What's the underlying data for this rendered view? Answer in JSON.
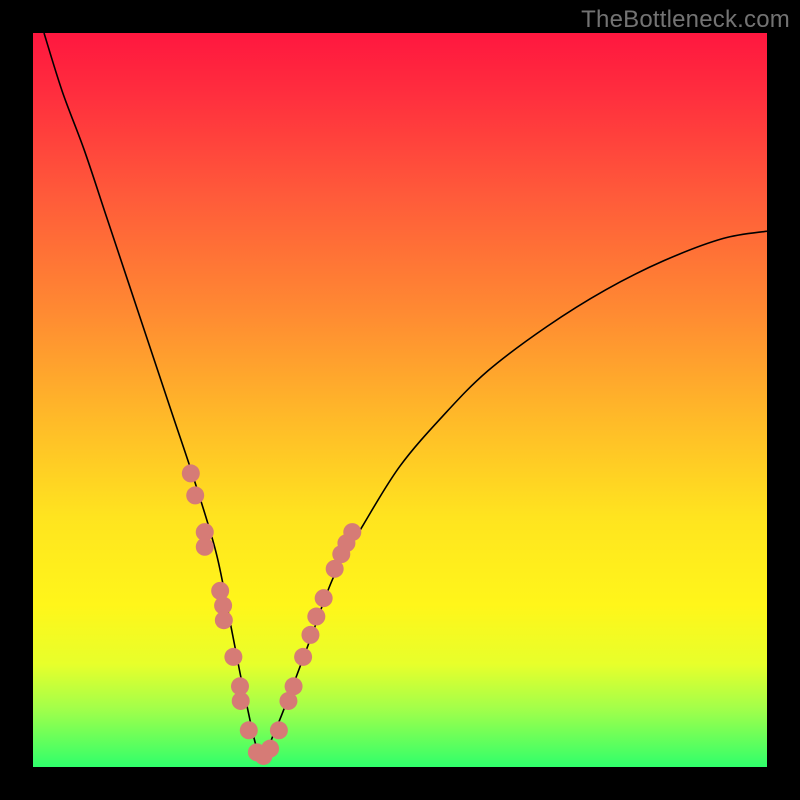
{
  "watermark": "TheBottleneck.com",
  "colors": {
    "gradient_top": "#ff173f",
    "gradient_mid_orange": "#ff8a32",
    "gradient_mid_yellow": "#ffe41f",
    "gradient_bottom": "#2fff6b",
    "curve": "#000000",
    "markers": "#d67b76",
    "frame": "#000000"
  },
  "chart_data": {
    "type": "line",
    "title": "",
    "xlabel": "",
    "ylabel": "",
    "xlim": [
      0,
      100
    ],
    "ylim": [
      0,
      100
    ],
    "notes": "x maps horizontally across the colored plot area (0 at left, 100 at right); y is the bottleneck percentage (0 at bottom/green = best match, 100 at top/red = severe bottleneck). Single V-shaped curve with its minimum near x≈31. Left branch descends steeply from top-left; right branch rises gradually toward the upper-right and levels off around y≈73.",
    "series": [
      {
        "name": "bottleneck-curve",
        "x": [
          1.5,
          4,
          7,
          10,
          13,
          16,
          19,
          22,
          25,
          27,
          29,
          31,
          33,
          35,
          38,
          41,
          45,
          50,
          56,
          62,
          70,
          78,
          86,
          94,
          100
        ],
        "y": [
          100,
          92,
          84,
          75,
          66,
          57,
          48,
          39,
          29,
          19,
          9,
          1.5,
          5,
          10,
          18,
          26,
          33,
          41,
          48,
          54,
          60,
          65,
          69,
          72,
          73
        ]
      }
    ],
    "markers": {
      "name": "highlighted-points",
      "note": "Salmon dots clustered along both sides of the curve's minimum (roughly the lower third of the V).",
      "points": [
        {
          "x": 21.5,
          "y": 40
        },
        {
          "x": 22.1,
          "y": 37
        },
        {
          "x": 23.4,
          "y": 32
        },
        {
          "x": 23.4,
          "y": 30
        },
        {
          "x": 25.5,
          "y": 24
        },
        {
          "x": 25.9,
          "y": 22
        },
        {
          "x": 26.0,
          "y": 20
        },
        {
          "x": 27.3,
          "y": 15
        },
        {
          "x": 28.2,
          "y": 11
        },
        {
          "x": 28.3,
          "y": 9
        },
        {
          "x": 29.4,
          "y": 5
        },
        {
          "x": 30.5,
          "y": 2
        },
        {
          "x": 31.4,
          "y": 1.5
        },
        {
          "x": 32.3,
          "y": 2.5
        },
        {
          "x": 33.5,
          "y": 5
        },
        {
          "x": 34.8,
          "y": 9
        },
        {
          "x": 35.5,
          "y": 11
        },
        {
          "x": 36.8,
          "y": 15
        },
        {
          "x": 37.8,
          "y": 18
        },
        {
          "x": 38.6,
          "y": 20.5
        },
        {
          "x": 39.6,
          "y": 23
        },
        {
          "x": 41.1,
          "y": 27
        },
        {
          "x": 42.0,
          "y": 29
        },
        {
          "x": 42.7,
          "y": 30.5
        },
        {
          "x": 43.5,
          "y": 32
        }
      ]
    }
  }
}
